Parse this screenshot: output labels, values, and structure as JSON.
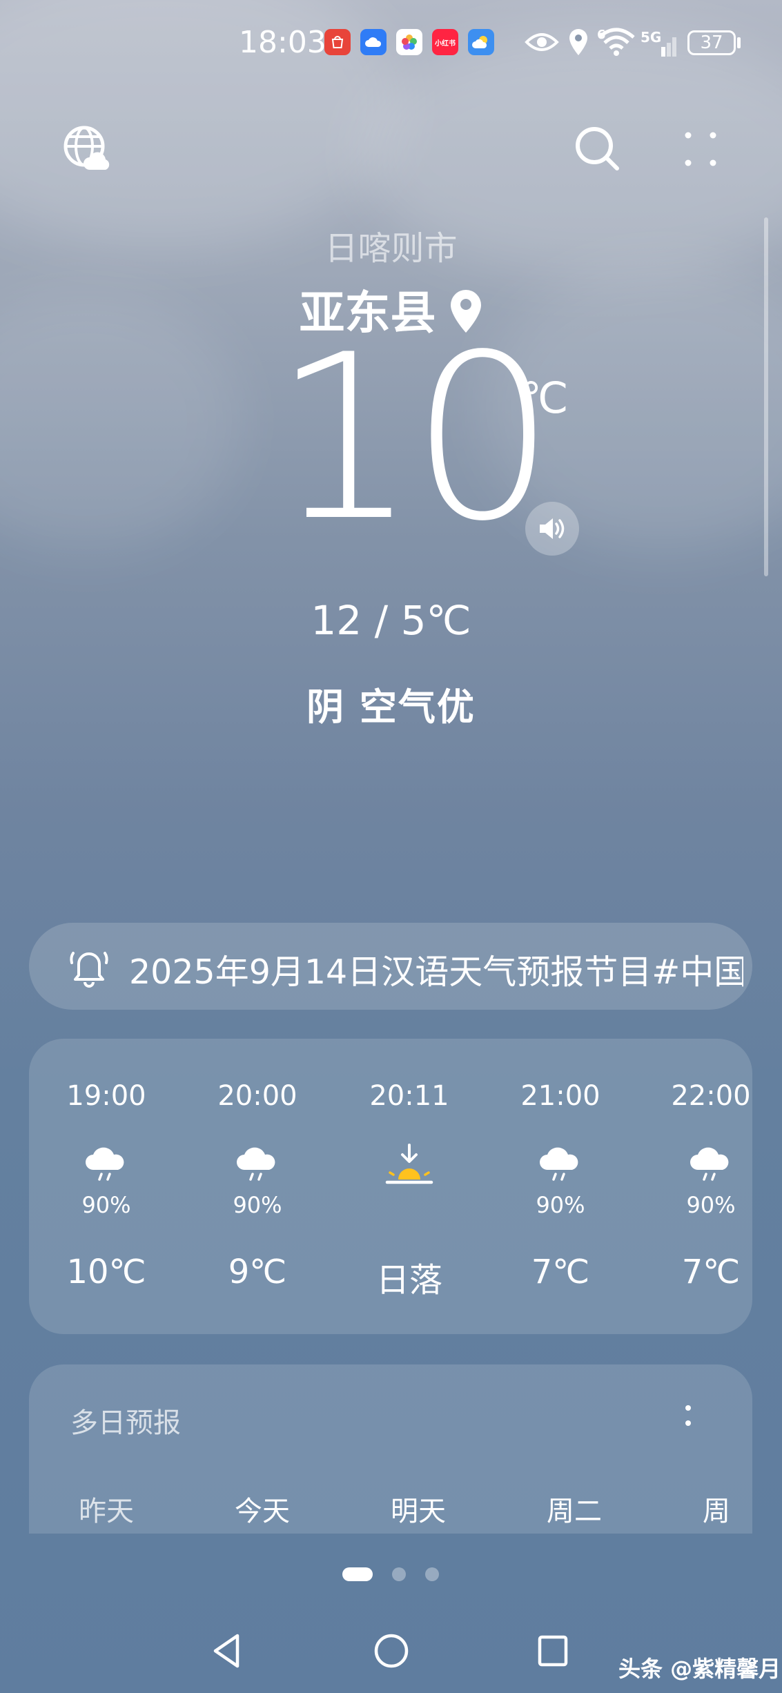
{
  "status_bar": {
    "time": "18:03",
    "apps": [
      {
        "name": "huawei-appgallery",
        "label": "HUAWEI",
        "color": "#e8443a"
      },
      {
        "name": "huawei-cloud",
        "label": "",
        "color": "#2f7cf6"
      },
      {
        "name": "gallery",
        "label": "",
        "color": "#ffffff"
      },
      {
        "name": "xiaohongshu",
        "label": "小红书",
        "color": "#ff2442"
      },
      {
        "name": "weather",
        "label": "",
        "color": "#3d8ff0"
      }
    ],
    "signal_label": "5G",
    "wifi_label": "6",
    "battery": "37"
  },
  "location": {
    "province": "日喀则市",
    "city": "亚东县"
  },
  "current": {
    "temp": "10",
    "unit": "℃",
    "range": "12 / 5℃",
    "condition": "阴  空气优"
  },
  "notice": {
    "text": "2025年9月14日汉语天气预报节目#中国"
  },
  "hourly": [
    {
      "time": "19:00",
      "icon": "rain-cloud-icon",
      "pop": "90%",
      "temp": "10℃"
    },
    {
      "time": "20:00",
      "icon": "rain-cloud-icon",
      "pop": "90%",
      "temp": "9℃"
    },
    {
      "time": "20:11",
      "icon": "sunset-icon",
      "pop": "",
      "temp": "日落"
    },
    {
      "time": "21:00",
      "icon": "rain-cloud-icon",
      "pop": "90%",
      "temp": "7℃"
    },
    {
      "time": "22:00",
      "icon": "rain-cloud-icon",
      "pop": "90%",
      "temp": "7℃"
    }
  ],
  "daily": {
    "title": "多日预报",
    "days": [
      "昨天",
      "今天",
      "明天",
      "周二",
      "周三"
    ]
  },
  "pages": {
    "active": 1,
    "count": 3
  },
  "watermark": "头条 @紫精馨月"
}
